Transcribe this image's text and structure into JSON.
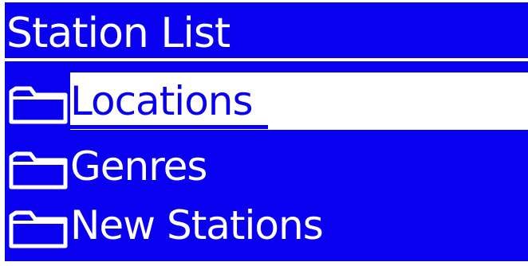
{
  "screen": {
    "background_color": "#0a00f0",
    "foreground_color": "#ffffff",
    "title": "Station List"
  },
  "menu": {
    "selected_index": 0,
    "items": [
      {
        "icon": "folder-icon",
        "label": "Locations"
      },
      {
        "icon": "folder-icon",
        "label": "Genres"
      },
      {
        "icon": "folder-icon",
        "label": "New Stations"
      }
    ]
  }
}
